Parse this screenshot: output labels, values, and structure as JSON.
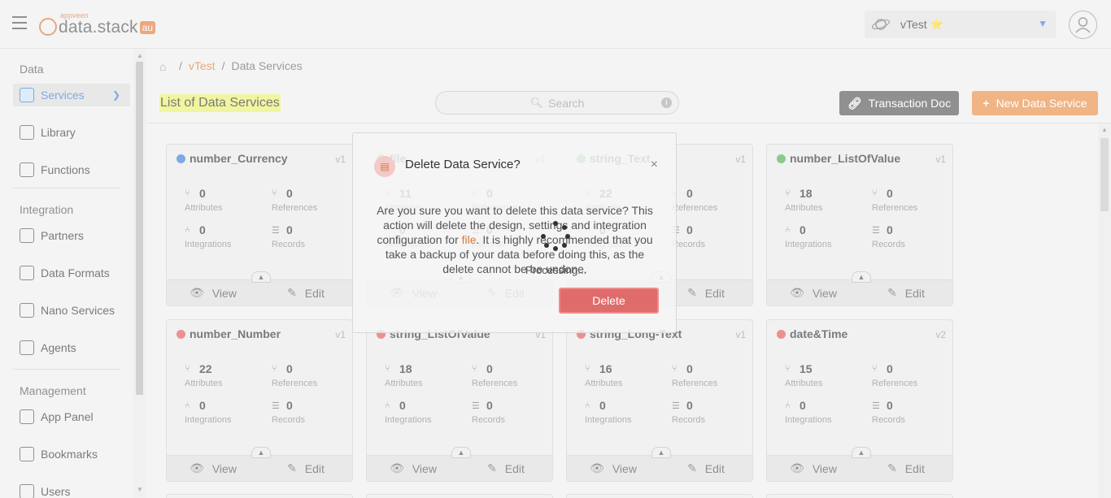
{
  "header": {
    "logo_small": "appveen",
    "logo_text": "data.stack",
    "logo_badge": "au",
    "app_name": "vTest",
    "app_star": "⭐"
  },
  "sidebar": {
    "sections": [
      {
        "label": "Data"
      },
      {
        "label": "Integration"
      },
      {
        "label": "Management"
      }
    ],
    "items": [
      {
        "label": "Services",
        "icon": "services-icon",
        "active": true
      },
      {
        "label": "Library",
        "icon": "library-icon"
      },
      {
        "label": "Functions",
        "icon": "functions-icon"
      },
      {
        "label": "Partners",
        "icon": "partners-icon"
      },
      {
        "label": "Data Formats",
        "icon": "data-formats-icon"
      },
      {
        "label": "Nano Services",
        "icon": "nano-services-icon"
      },
      {
        "label": "Agents",
        "icon": "agents-icon"
      },
      {
        "label": "App Panel",
        "icon": "app-panel-icon"
      },
      {
        "label": "Bookmarks",
        "icon": "bookmarks-icon"
      },
      {
        "label": "Users",
        "icon": "users-icon"
      }
    ]
  },
  "breadcrumb": {
    "app": "vTest",
    "current": "Data Services",
    "sep": "/"
  },
  "page": {
    "title": "List of Data Services",
    "search_placeholder": "Search",
    "transaction_doc": "Transaction Doc",
    "new_service": "New Data Service"
  },
  "card_labels": {
    "attributes": "Attributes",
    "references": "References",
    "integrations": "Integrations",
    "records": "Records",
    "view": "View",
    "edit": "Edit"
  },
  "cards": [
    {
      "name": "number_Currency",
      "version": "v1",
      "status_color": "#3b7bd6",
      "attributes": "0",
      "references": "0",
      "integrations": "0",
      "records": "0"
    },
    {
      "name": "file",
      "version": "v1",
      "status_color": "#4caf50",
      "attributes": "11",
      "references": "0",
      "integrations": "0",
      "records": "0"
    },
    {
      "name": "string_Text",
      "version": "v1",
      "status_color": "#4caf50",
      "attributes": "22",
      "references": "0",
      "integrations": "0",
      "records": "0"
    },
    {
      "name": "number_ListOfValue",
      "version": "v1",
      "status_color": "#4caf50",
      "attributes": "18",
      "references": "0",
      "integrations": "0",
      "records": "0"
    },
    {
      "name": "number_Number",
      "version": "v1",
      "status_color": "#e05757",
      "attributes": "22",
      "references": "0",
      "integrations": "0",
      "records": "0"
    },
    {
      "name": "string_ListOfValue",
      "version": "v1",
      "status_color": "#e05757",
      "attributes": "18",
      "references": "0",
      "integrations": "0",
      "records": "0"
    },
    {
      "name": "string_Long-Text",
      "version": "v1",
      "status_color": "#e05757",
      "attributes": "16",
      "references": "0",
      "integrations": "0",
      "records": "0"
    },
    {
      "name": "date&Time",
      "version": "v2",
      "status_color": "#e05757",
      "attributes": "15",
      "references": "0",
      "integrations": "0",
      "records": "0"
    }
  ],
  "modal": {
    "title": "Delete Data Service?",
    "close": "×",
    "body_pre": "Are you sure you want to delete this data service? This action will delete the design, settings and integration configuration for ",
    "body_name": "file",
    "body_post": ". It is highly recommended that you take a backup of your data before doing this, as the delete cannot be be undone.",
    "processing": "Processing...",
    "delete_label": "Delete"
  }
}
